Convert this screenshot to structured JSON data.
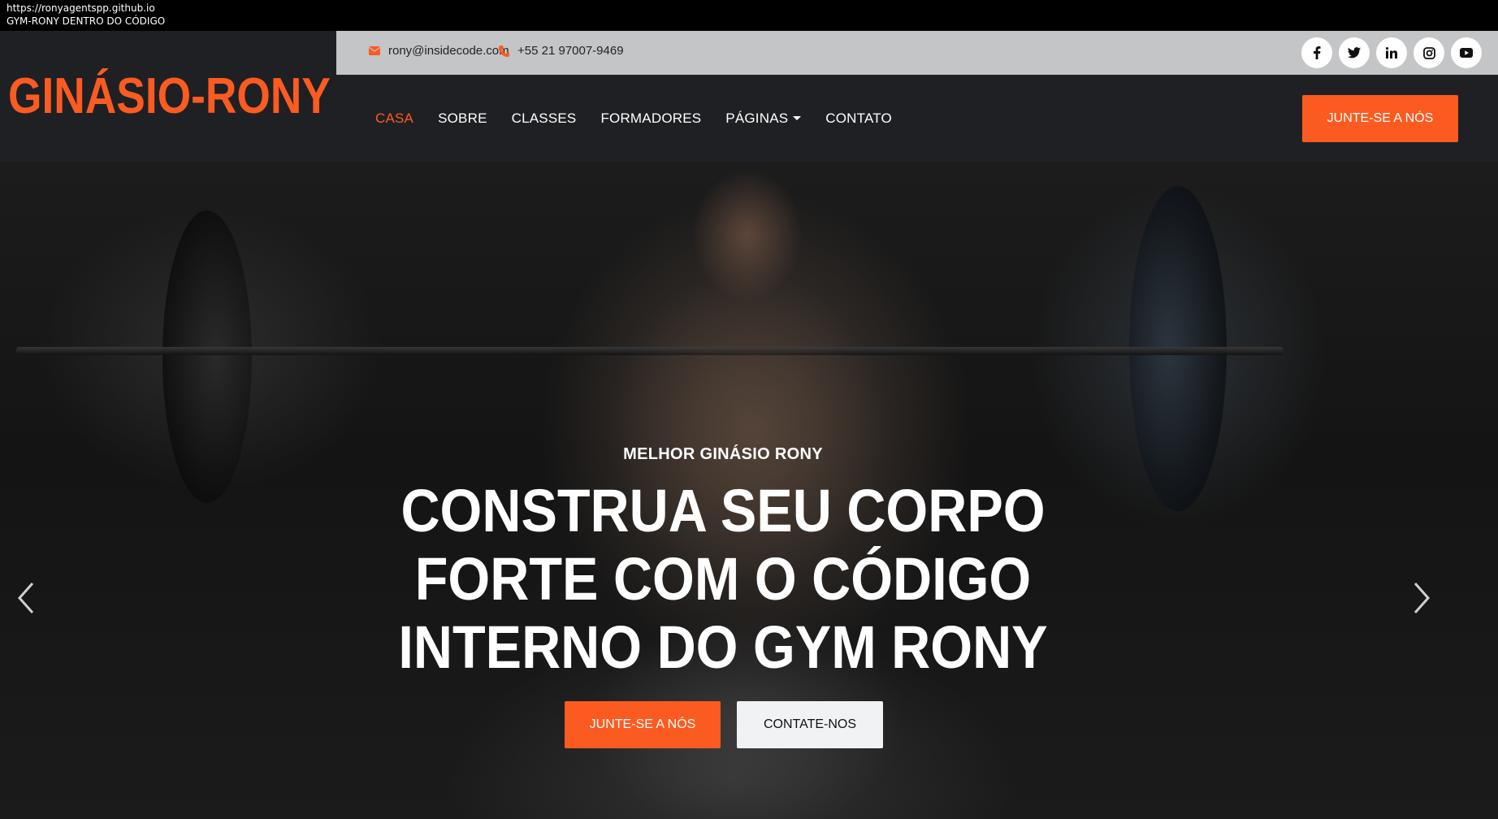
{
  "browser": {
    "url": "https://ronyagentspp.github.io",
    "tab_title": "GYM-RONY DENTRO DO CÓDIGO"
  },
  "brand": {
    "name": "GINÁSIO-RONY",
    "color": "#fb5b21"
  },
  "topbar": {
    "email": "rony@insidecode.com",
    "phone": "+55 21 97007-9469",
    "email_icon": "envelope-icon",
    "phone_icon": "phone-icon",
    "socials": [
      "facebook-icon",
      "twitter-icon",
      "linkedin-icon",
      "instagram-icon",
      "youtube-icon"
    ]
  },
  "nav": {
    "items": [
      {
        "label": "CASA",
        "active": true
      },
      {
        "label": "SOBRE",
        "active": false
      },
      {
        "label": "CLASSES",
        "active": false
      },
      {
        "label": "FORMADORES",
        "active": false
      },
      {
        "label": "PÁGINAS",
        "active": false,
        "dropdown": true
      },
      {
        "label": "CONTATO",
        "active": false
      }
    ],
    "cta": "JUNTE-SE A NÓS"
  },
  "hero": {
    "subtitle": "MELHOR GINÁSIO RONY",
    "title_lines": [
      "CONSTRUA SEU CORPO",
      "FORTE COM O CÓDIGO",
      "INTERNO DO GYM RONY"
    ],
    "primary_button": "JUNTE-SE A NÓS",
    "secondary_button": "CONTATE-NOS",
    "prev_icon": "chevron-left-icon",
    "next_icon": "chevron-right-icon"
  },
  "colors": {
    "accent": "#fb5b21",
    "header_bg": "#1f2024",
    "topbar_bg": "#c4c5c7"
  }
}
